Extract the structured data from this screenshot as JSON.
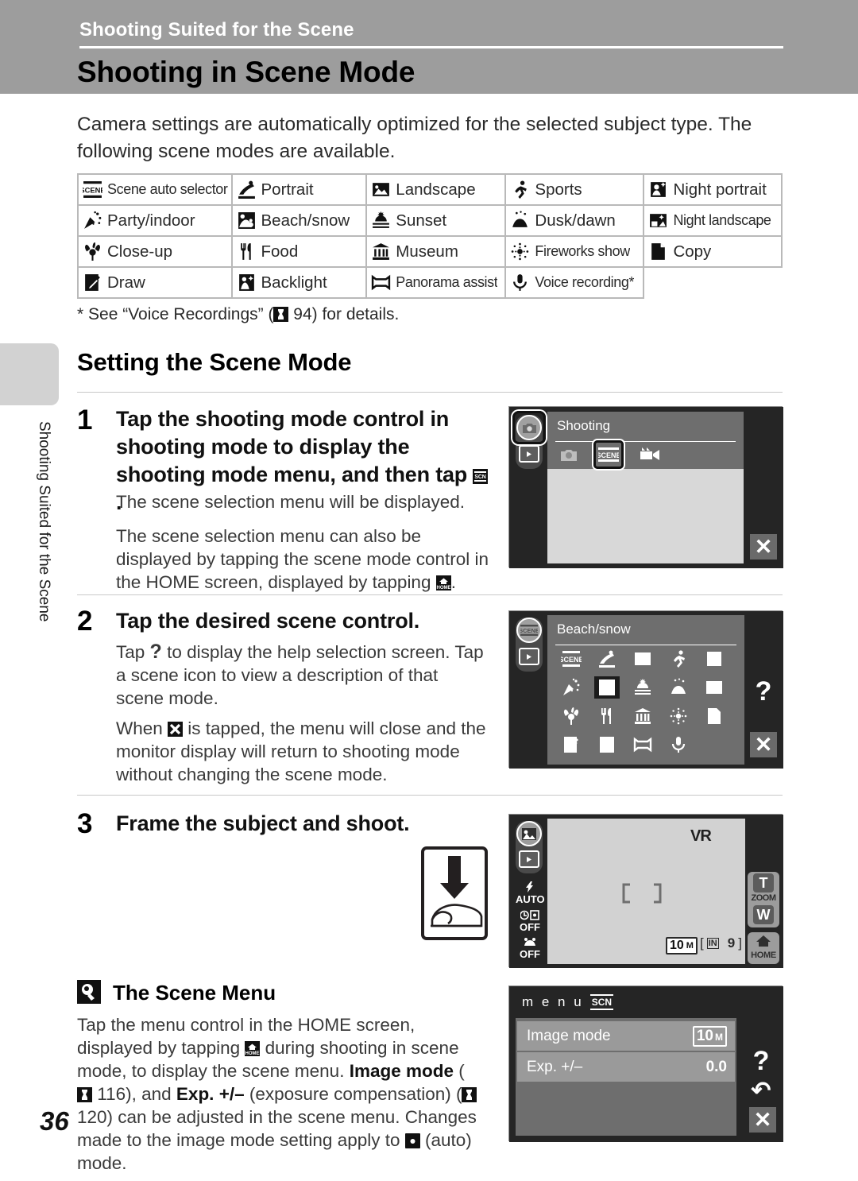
{
  "header": {
    "running_head": "Shooting Suited for the Scene",
    "chapter_title": "Shooting in Scene Mode"
  },
  "side_tab_text": "Shooting Suited for the Scene",
  "intro": "Camera settings are automatically optimized for the selected subject type. The following scene modes are available.",
  "scene_table": {
    "rows": [
      [
        {
          "icon": "scene-auto-selector-icon",
          "label": "Scene auto selector",
          "tight": true
        },
        {
          "icon": "portrait-icon",
          "label": "Portrait"
        },
        {
          "icon": "landscape-icon",
          "label": "Landscape"
        },
        {
          "icon": "sports-icon",
          "label": "Sports"
        },
        {
          "icon": "night-portrait-icon",
          "label": "Night portrait"
        }
      ],
      [
        {
          "icon": "party-indoor-icon",
          "label": "Party/indoor"
        },
        {
          "icon": "beach-snow-icon",
          "label": "Beach/snow"
        },
        {
          "icon": "sunset-icon",
          "label": "Sunset"
        },
        {
          "icon": "dusk-dawn-icon",
          "label": "Dusk/dawn"
        },
        {
          "icon": "night-landscape-icon",
          "label": "Night landscape",
          "tight": true
        }
      ],
      [
        {
          "icon": "close-up-icon",
          "label": "Close-up"
        },
        {
          "icon": "food-icon",
          "label": "Food"
        },
        {
          "icon": "museum-icon",
          "label": "Museum"
        },
        {
          "icon": "fireworks-icon",
          "label": "Fireworks show",
          "tight": true
        },
        {
          "icon": "copy-icon",
          "label": "Copy"
        }
      ],
      [
        {
          "icon": "draw-icon",
          "label": "Draw"
        },
        {
          "icon": "backlight-icon",
          "label": "Backlight"
        },
        {
          "icon": "panorama-assist-icon",
          "label": "Panorama assist",
          "tight": true
        },
        {
          "icon": "voice-recording-icon",
          "label": "Voice recording*",
          "tight": true
        },
        {
          "icon": "",
          "label": "",
          "empty": true
        }
      ]
    ]
  },
  "footnote": {
    "before": "* See “Voice Recordings” (",
    "after": " 94) for details."
  },
  "section_title": "Setting the Scene Mode",
  "steps": [
    {
      "num": "1",
      "title_before": "Tap the shooting mode control in shooting mode to display the shooting mode menu, and then tap ",
      "title_after": ".",
      "body1": "The scene selection menu will be displayed.",
      "body2_before": "The scene selection menu can also be displayed by tapping the scene mode control in the HOME screen, displayed by tapping ",
      "body2_after": "."
    },
    {
      "num": "2",
      "title": "Tap the desired scene control.",
      "body1_before": "Tap ",
      "body1_after": " to display the help selection screen. Tap a scene icon to view a description of that scene mode.",
      "body2_before": "When ",
      "body2_after": " is tapped, the menu will close and the monitor display will return to shooting mode without changing the scene mode."
    },
    {
      "num": "3",
      "title": "Frame the subject and shoot."
    }
  ],
  "screens": {
    "shooting_mode_menu": {
      "title": "Shooting",
      "mode_icons": [
        "camera-auto-icon",
        "scene-icon",
        "movie-icon"
      ],
      "selected": "scene-icon",
      "side_buttons": [
        "camera-mode-button",
        "playback-button"
      ],
      "close_label": "✕"
    },
    "scene_selection": {
      "title": "Beach/snow",
      "selected": "beach-snow-icon",
      "grid_icons": [
        "scene-auto-selector-icon",
        "portrait-icon",
        "landscape-icon",
        "sports-icon",
        "night-portrait-icon",
        "party-indoor-icon",
        "beach-snow-icon",
        "sunset-icon",
        "dusk-dawn-icon",
        "night-landscape-icon",
        "close-up-icon",
        "food-icon",
        "museum-icon",
        "fireworks-icon",
        "copy-icon",
        "draw-icon",
        "backlight-icon",
        "panorama-assist-icon",
        "voice-recording-icon"
      ],
      "help_label": "?",
      "close_label": "✕",
      "side_buttons": [
        "scene-mode-button",
        "playback-button"
      ]
    },
    "live_view": {
      "vr_label": "VR",
      "image_mode_label": "10",
      "image_mode_unit": "M",
      "memory_label": "IN",
      "shots_remaining": "9",
      "zoom_label": "ZOOM",
      "zoom_tele": "T",
      "zoom_wide": "W",
      "home_label": "HOME",
      "flash_label": "AUTO",
      "selftimer_label": "OFF",
      "macro_label": "OFF",
      "side_buttons": [
        "scene-mode-button",
        "playback-button"
      ]
    },
    "scene_menu": {
      "menu_word": "m e n u",
      "menu_badge": "SCN",
      "rows": [
        {
          "label": "Image mode",
          "value": "10",
          "value_unit": "M"
        },
        {
          "label": "Exp. +/–",
          "value": "0.0"
        }
      ],
      "help_label": "?",
      "back_label": "↶",
      "close_label": "✕"
    }
  },
  "tip": {
    "title": "The Scene Menu",
    "seg1": "Tap the menu control in the HOME screen, displayed by tapping ",
    "seg2": " during shooting in scene mode, to display the scene menu. ",
    "bold1": "Image mode",
    "seg3": " (",
    "seg4": " 116), and ",
    "bold2": "Exp. +/–",
    "seg5": " (exposure compensation) (",
    "seg6": " 120) can be adjusted in the scene menu. Changes made to the image mode setting apply to ",
    "seg7": " (auto) mode."
  },
  "page_number": "36"
}
